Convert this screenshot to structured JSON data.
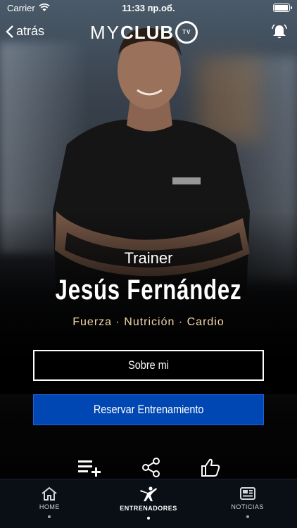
{
  "status_bar": {
    "carrier": "Carrier",
    "time": "11:33 пр.об."
  },
  "nav": {
    "back_label": "atrás",
    "logo_my": "MY",
    "logo_club": "CLUB",
    "logo_tv": "TV"
  },
  "profile": {
    "role": "Trainer",
    "name": "Jesús Fernández",
    "specialties": "Fuerza · Nutrición · Cardio"
  },
  "buttons": {
    "about": "Sobre mi",
    "book": "Reservar Entrenamiento"
  },
  "actions": [
    {
      "icon": "add-to-list-icon"
    },
    {
      "icon": "share-icon"
    },
    {
      "icon": "thumbs-up-icon"
    }
  ],
  "tabbar": {
    "items": [
      {
        "label": "HOME",
        "icon": "home-icon",
        "active": false
      },
      {
        "label": "ENTRENADORES",
        "icon": "trainer-icon",
        "active": true
      },
      {
        "label": "NOTICIAS",
        "icon": "news-icon",
        "active": false
      }
    ]
  },
  "colors": {
    "primary_button": "#0047b3",
    "specialties_text": "#f2d6a6",
    "tabbar_bg": "#0a0f15"
  }
}
